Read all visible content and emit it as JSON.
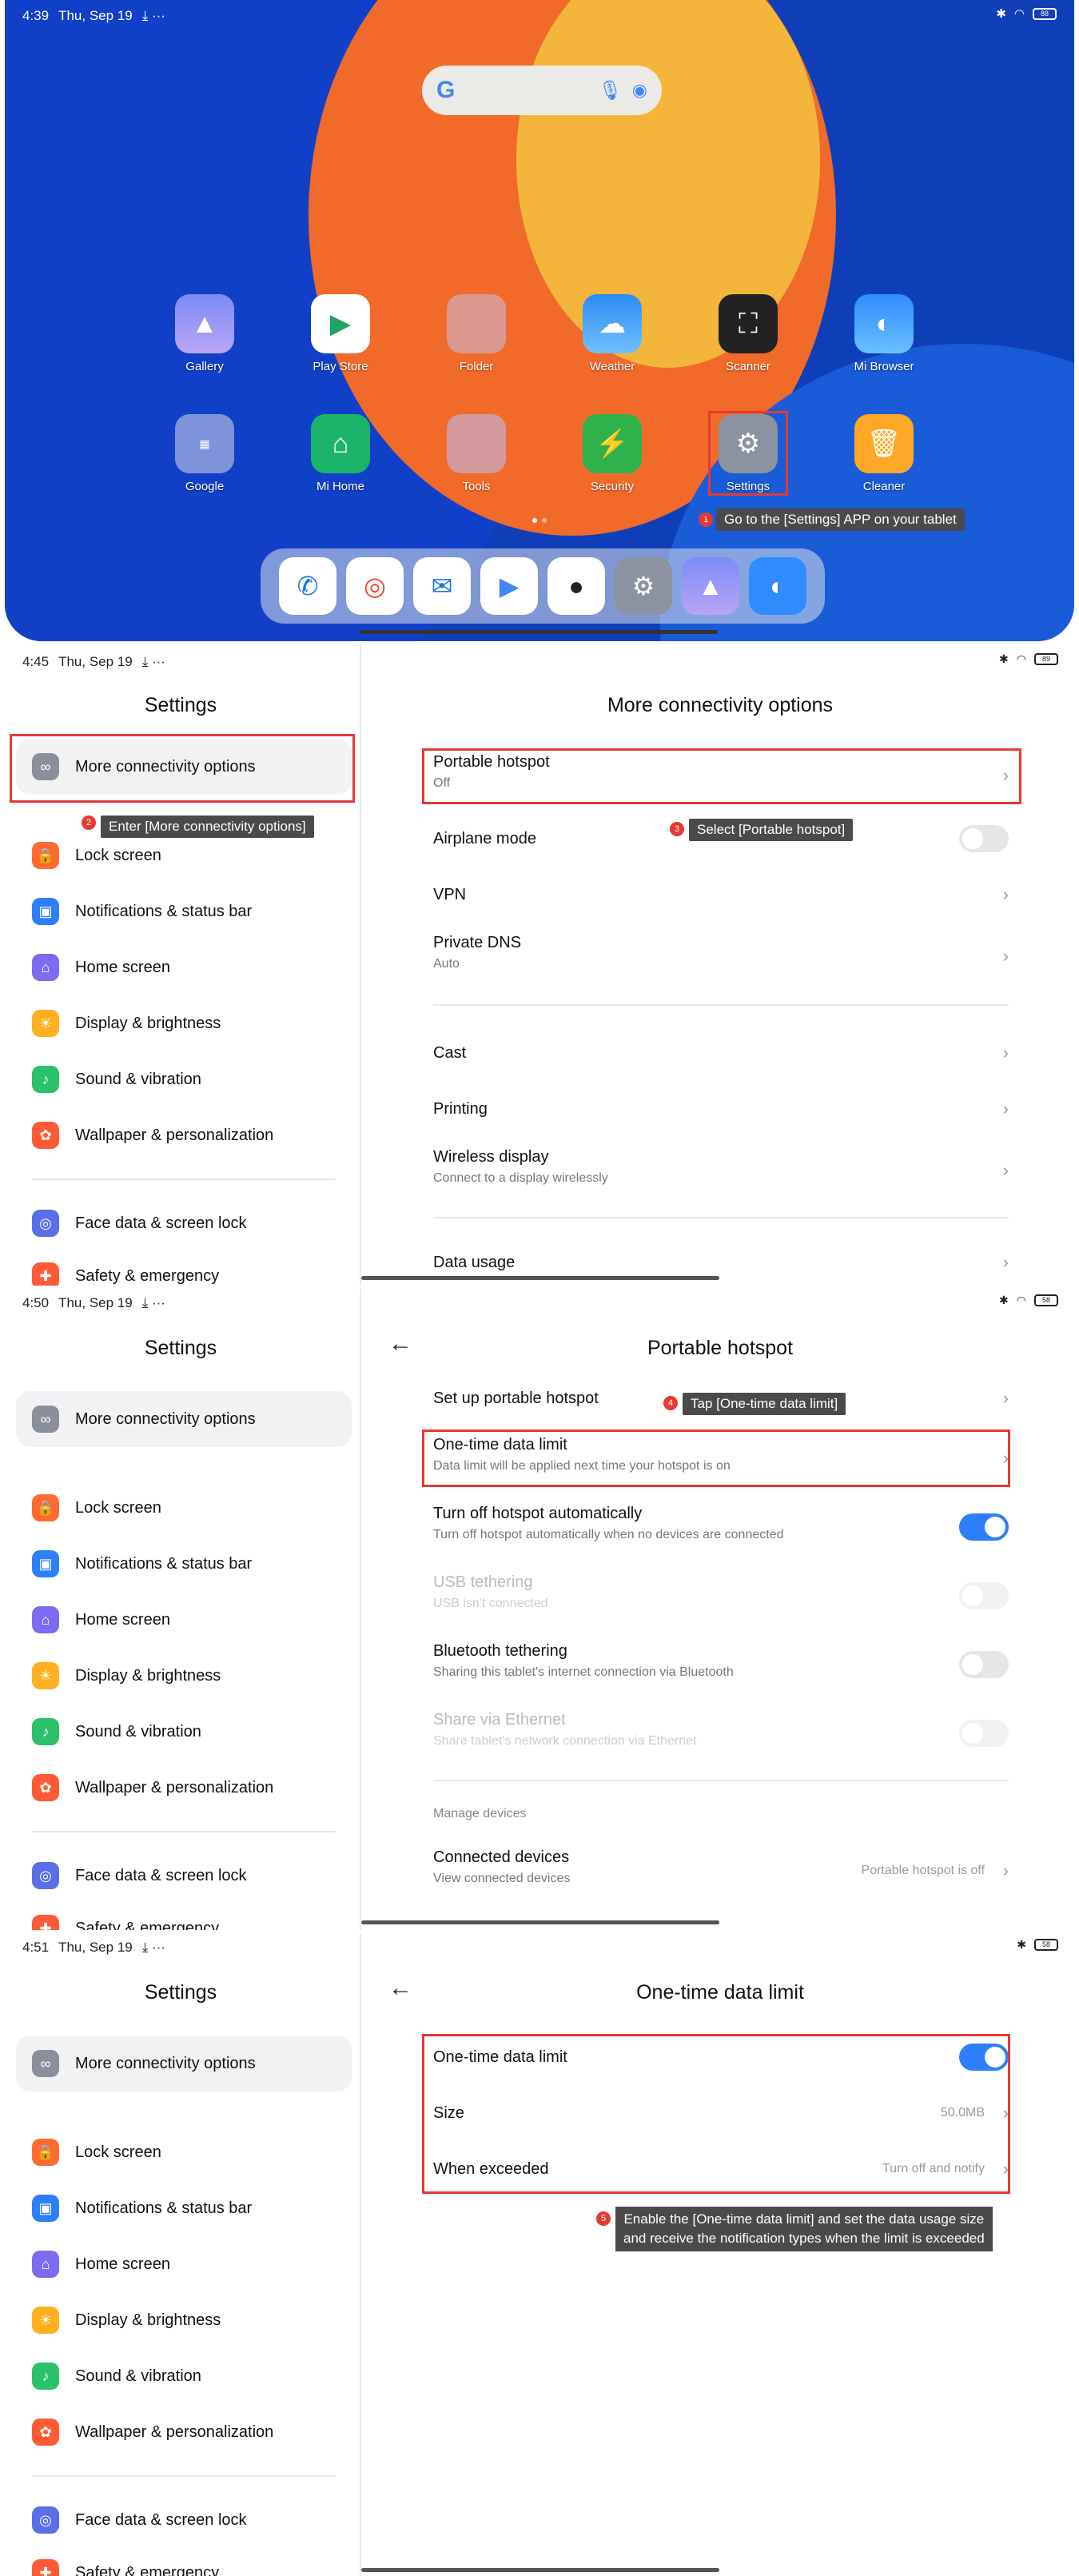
{
  "status": {
    "p1": {
      "time": "4:39",
      "date": "Thu, Sep 19",
      "batt": "88"
    },
    "p2": {
      "time": "4:45",
      "date": "Thu, Sep 19",
      "batt": "89"
    },
    "p3": {
      "time": "4:50",
      "date": "Thu, Sep 19",
      "batt": "58"
    },
    "p4": {
      "time": "4:51",
      "date": "Thu, Sep 19",
      "batt": "58"
    }
  },
  "home": {
    "apps_row1": [
      "Gallery",
      "Play Store",
      "Folder",
      "Weather",
      "Scanner",
      "Mi Browser"
    ],
    "apps_row2": [
      "Google",
      "Mi Home",
      "Tools",
      "Security",
      "Settings",
      "Cleaner"
    ],
    "step1": "Go to the [Settings] APP on your tablet"
  },
  "settings_left": {
    "title": "Settings",
    "items": [
      "More connectivity options",
      "Lock screen",
      "Notifications & status bar",
      "Home screen",
      "Display & brightness",
      "Sound & vibration",
      "Wallpaper & personalization",
      "Face data & screen lock",
      "Safety & emergency"
    ]
  },
  "p2": {
    "title": "More connectivity options",
    "step2": "Enter [More connectivity options]",
    "step3": "Select [Portable hotspot]",
    "items": [
      {
        "t": "Portable hotspot",
        "s": "Off"
      },
      {
        "t": "Airplane mode",
        "s": ""
      },
      {
        "t": "VPN",
        "s": ""
      },
      {
        "t": "Private DNS",
        "s": "Auto"
      },
      {
        "t": "Cast",
        "s": ""
      },
      {
        "t": "Printing",
        "s": ""
      },
      {
        "t": "Wireless display",
        "s": "Connect to a display wirelessly"
      },
      {
        "t": "Data usage",
        "s": ""
      }
    ]
  },
  "p3": {
    "title": "Portable hotspot",
    "step4": "Tap [One-time data limit]",
    "items": [
      {
        "t": "Set up portable hotspot",
        "s": ""
      },
      {
        "t": "One-time data limit",
        "s": "Data limit will be applied next time your hotspot is on"
      },
      {
        "t": "Turn off hotspot automatically",
        "s": "Turn off hotspot automatically when no devices are connected"
      },
      {
        "t": "USB tethering",
        "s": "USB isn't connected"
      },
      {
        "t": "Bluetooth tethering",
        "s": "Sharing this tablet's internet connection via Bluetooth"
      },
      {
        "t": "Share via Ethernet",
        "s": "Share tablet's network connection via Ethernet"
      }
    ],
    "group": "Manage devices",
    "connected": {
      "t": "Connected devices",
      "s": "View connected devices",
      "v": "Portable hotspot is off"
    }
  },
  "p4": {
    "title": "One-time data limit",
    "items": [
      {
        "t": "One-time data limit",
        "v": ""
      },
      {
        "t": "Size",
        "v": "50.0MB"
      },
      {
        "t": "When exceeded",
        "v": "Turn off and notify"
      }
    ],
    "step5a": "Enable the [One-time data limit] and set the data usage size",
    "step5b": "and receive the notification types when the limit is exceeded"
  },
  "steps": [
    "1",
    "2",
    "3",
    "4",
    "5"
  ],
  "colors": {
    "accent": "#2d7ff9",
    "highlight": "#e53935",
    "tooltip": "#4a4a4a"
  }
}
